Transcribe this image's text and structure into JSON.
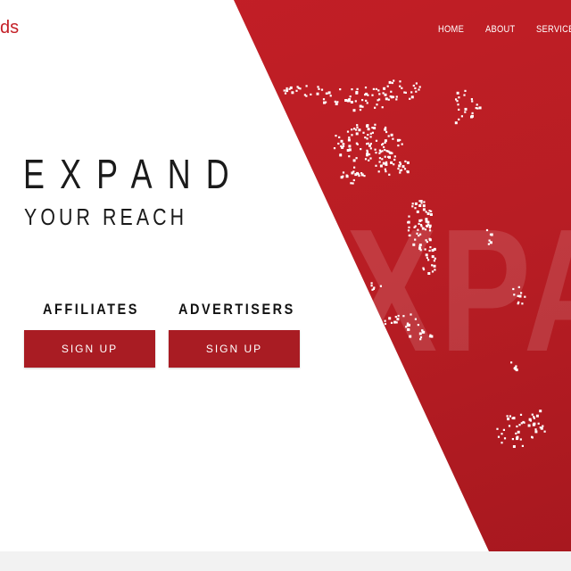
{
  "brand": {
    "logo_text": "ds",
    "accent_color": "#c41f26"
  },
  "nav": {
    "items": [
      {
        "label": "HOME"
      },
      {
        "label": "ABOUT"
      },
      {
        "label": "SERVICES"
      }
    ]
  },
  "hero": {
    "headline": "EXPAND",
    "subheadline": "YOUR REACH",
    "background_word": "XPA"
  },
  "cta": {
    "affiliates": {
      "label": "AFFILIATES",
      "button": "SIGN UP"
    },
    "advertisers": {
      "label": "ADVERTISERS",
      "button": "SIGN UP"
    }
  }
}
